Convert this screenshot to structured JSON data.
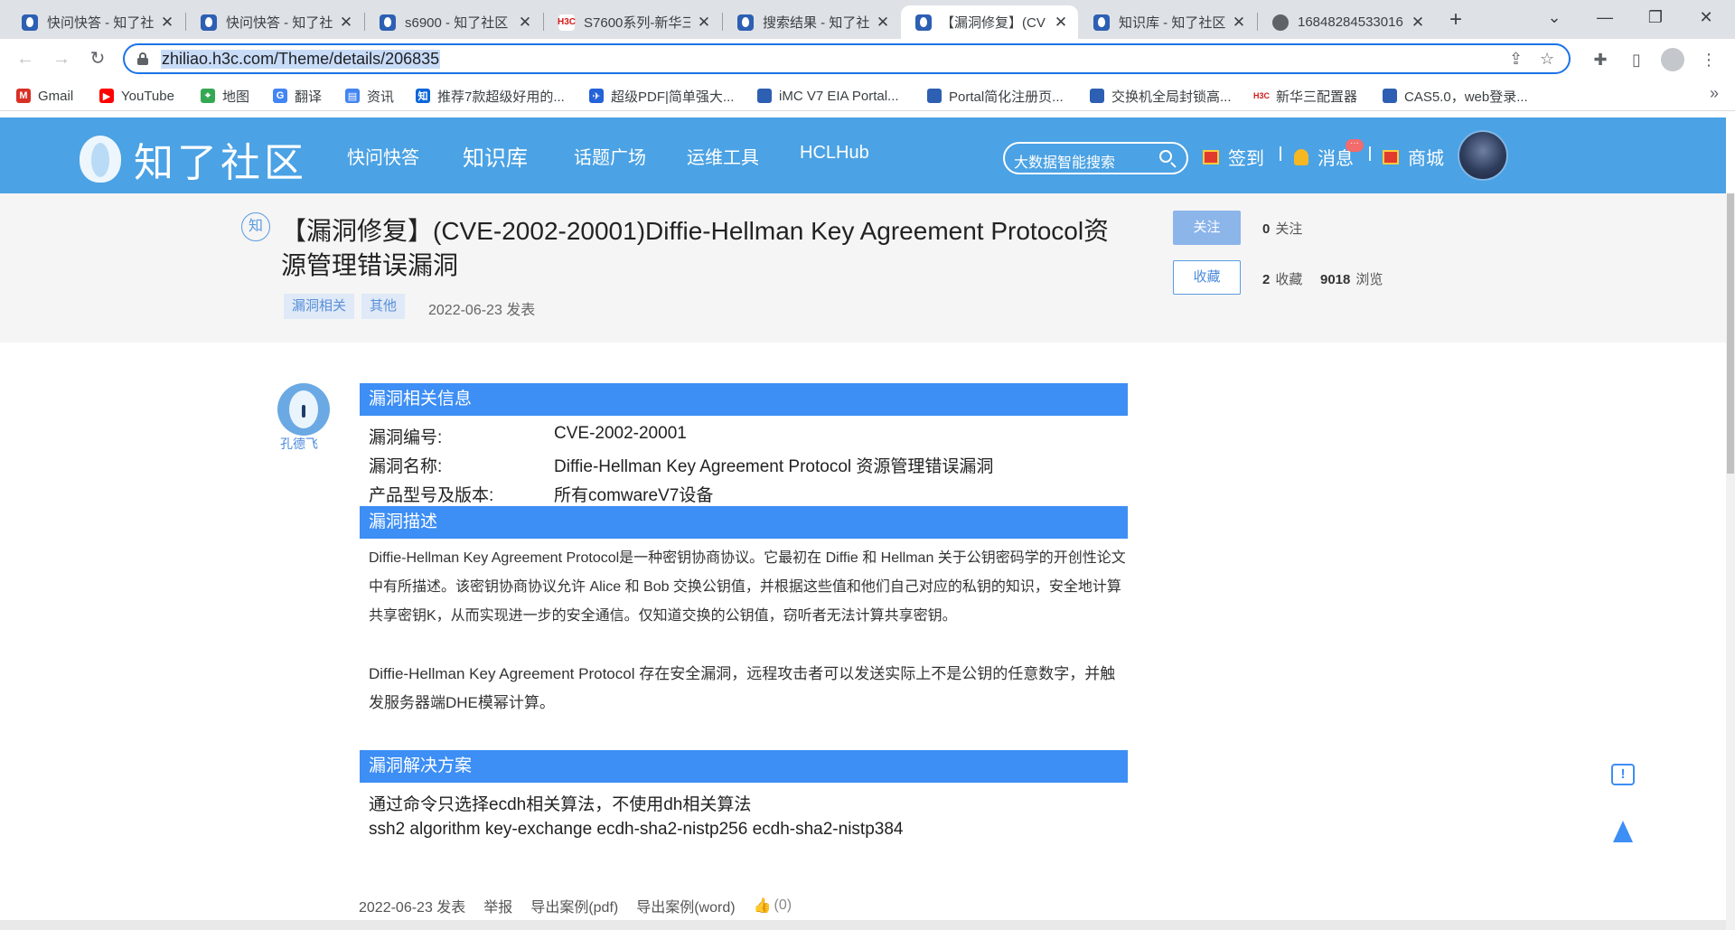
{
  "browser": {
    "tabs": [
      {
        "title": "快问快答 - 知了社",
        "icon": "zhiliao-icon"
      },
      {
        "title": "快问快答 - 知了社",
        "icon": "zhiliao-icon"
      },
      {
        "title": "s6900 - 知了社区",
        "icon": "zhiliao-icon"
      },
      {
        "title": "S7600系列-新华三",
        "icon": "h3c-icon"
      },
      {
        "title": "搜索结果 - 知了社",
        "icon": "zhiliao-icon"
      },
      {
        "title": "【漏洞修复】(CV",
        "icon": "zhiliao-icon",
        "active": true
      },
      {
        "title": "知识库 - 知了社区",
        "icon": "zhiliao-icon"
      },
      {
        "title": "16848284533016",
        "icon": "globe-icon"
      }
    ],
    "url": "zhiliao.h3c.com/Theme/details/206835",
    "bookmarks": [
      {
        "label": "Gmail",
        "icon": "gmail-icon",
        "color": "#d93025"
      },
      {
        "label": "YouTube",
        "icon": "youtube-icon",
        "color": "#ff0000"
      },
      {
        "label": "地图",
        "icon": "maps-icon",
        "color": "#34a853"
      },
      {
        "label": "翻译",
        "icon": "translate-icon",
        "color": "#4285f4"
      },
      {
        "label": "资讯",
        "icon": "news-icon",
        "color": "#4285f4"
      },
      {
        "label": "推荐7款超级好用的...",
        "icon": "zhihu-icon",
        "color": "#0a66d8"
      },
      {
        "label": "超级PDF|简单强大...",
        "icon": "pdf-icon",
        "color": "#2462d8"
      },
      {
        "label": "iMC V7 EIA Portal...",
        "icon": "zhiliao-icon",
        "color": "#2d5fb3"
      },
      {
        "label": "Portal简化注册页...",
        "icon": "zhiliao-icon",
        "color": "#2d5fb3"
      },
      {
        "label": "交换机全局封锁高...",
        "icon": "zhiliao-icon",
        "color": "#2d5fb3"
      },
      {
        "label": "新华三配置器",
        "icon": "h3c-icon",
        "color": "#d51a1a"
      },
      {
        "label": "CAS5.0，web登录...",
        "icon": "zhiliao-icon",
        "color": "#2d5fb3"
      }
    ]
  },
  "site": {
    "logo_text": "知了社区",
    "nav": [
      "快问快答",
      "知识库",
      "话题广场",
      "运维工具",
      "HCLHub"
    ],
    "search_placeholder": "大数据智能搜索",
    "signin": "签到",
    "messages": "消息",
    "messages_badge": "···",
    "shop": "商城",
    "colors": {
      "header": "#4ba2e4",
      "section": "#3d8ef5"
    }
  },
  "article": {
    "badge": "知",
    "title": "【漏洞修复】(CVE-2002-20001)Diffie-Hellman Key Agreement Protocol资源管理错误漏洞",
    "tags": [
      "漏洞相关",
      "其他"
    ],
    "date": "2022-06-23 发表",
    "follow_label": "关注",
    "follow_count": "0",
    "follow_text": "关注",
    "fav_label": "收藏",
    "fav_count": "2",
    "fav_text": "收藏",
    "view_count": "9018",
    "view_text": "浏览",
    "author": "孔德飞",
    "sections": {
      "info_title": "漏洞相关信息",
      "info": [
        {
          "label": "漏洞编号:",
          "value": "CVE-2002-20001"
        },
        {
          "label": "漏洞名称:",
          "value": "Diffie-Hellman Key Agreement Protocol 资源管理错误漏洞"
        },
        {
          "label": "产品型号及版本:",
          "value": "所有comwareV7设备"
        }
      ],
      "desc_title": "漏洞描述",
      "desc_p1": "Diffie-Hellman Key Agreement Protocol是一种密钥协商协议。它最初在 Diffie 和 Hellman 关于公钥密码学的开创性论文中有所描述。该密钥协商协议允许 Alice 和 Bob 交换公钥值，并根据这些值和他们自己对应的私钥的知识，安全地计算共享密钥K，从而实现进一步的安全通信。仅知道交换的公钥值，窃听者无法计算共享密钥。",
      "desc_p2": "Diffie-Hellman Key Agreement Protocol 存在安全漏洞，远程攻击者可以发送实际上不是公钥的任意数字，并触发服务器端DHE模幂计算。",
      "solution_title": "漏洞解决方案",
      "solution_lines": [
        "通过命令只选择ecdh相关算法，不使用dh相关算法",
        "ssh2 algorithm key-exchange ecdh-sha2-nistp256 ecdh-sha2-nistp384"
      ]
    },
    "footer": {
      "date": "2022-06-23 发表",
      "report": "举报",
      "export_pdf": "导出案例(pdf)",
      "export_word": "导出案例(word)",
      "likes": "(0)"
    }
  }
}
